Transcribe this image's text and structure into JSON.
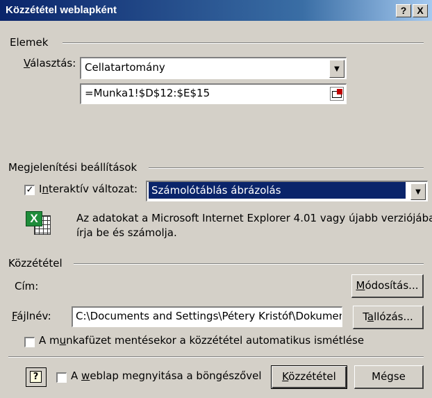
{
  "window": {
    "title": "Közzététel weblapként",
    "help_btn": "?",
    "close_btn": "X"
  },
  "elemek": {
    "group_label": "Elemek",
    "valasztas_label": "Választás:",
    "valasztas_value": "Cellatartomány",
    "range_value": "=Munka1!$D$12:$E$15"
  },
  "megjelenites": {
    "group_label": "Megjelenítési beállítások",
    "interactive_label": "Interaktív változat:",
    "interactive_checked": true,
    "interactive_value": "Számolótáblás ábrázolás",
    "info_line1": "Az adatokat a Microsoft Internet Explorer 4.01 vagy újabb verziójában",
    "info_line2": "írja be és számolja."
  },
  "kozzetetel": {
    "group_label": "Közzététel",
    "cim_label": "Cím:",
    "modositas_button": "Módosítás...",
    "fajlnev_label": "Fájlnév:",
    "fajlnev_value": "C:\\Documents and Settings\\Pétery Kristóf\\Dokumentu",
    "tallozas_button": "Tallózás...",
    "auto_repeat_label": "A munkafüzet mentésekor a közzététel automatikus ismétlése",
    "auto_repeat_checked": false
  },
  "footer": {
    "help_icon": "?",
    "open_browser_label": "A weblap megnyitása a böngészővel",
    "open_browser_checked": false,
    "publish_button": "Közzététel",
    "cancel_button": "Mégse"
  },
  "colors": {
    "title_bar": "#0a246a",
    "selection": "#0a246a",
    "dialog_bg": "#d4d0c8"
  },
  "icons": {
    "spreadsheet": "excel-icon",
    "dropdown": "chevron-down-icon",
    "range_picker": "range-collapse-icon"
  }
}
